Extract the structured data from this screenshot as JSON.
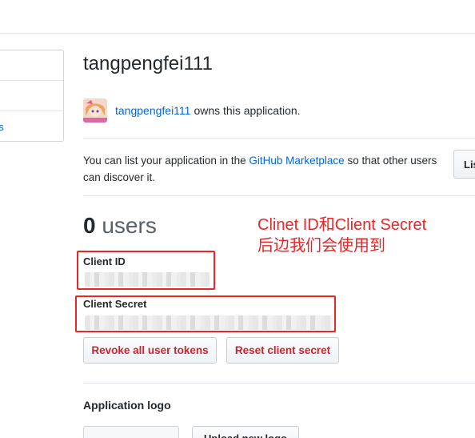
{
  "sidebar": {
    "items": [
      {
        "label": ""
      },
      {
        "label": ""
      },
      {
        "label": "ns"
      }
    ]
  },
  "app": {
    "title": "tangpengfei111",
    "owner_name": "tangpengfei111",
    "owner_text": "owns this application."
  },
  "marketplace": {
    "text_before": "You can list your application in the ",
    "link": "GitHub Marketplace",
    "text_after": " so that other users can discover it.",
    "button_label": "List"
  },
  "users": {
    "count": "0",
    "label": "users"
  },
  "annotation": {
    "line1": "Clinet ID和Client Secret",
    "line2": "后边我们会使用到"
  },
  "credentials": {
    "client_id_label": "Client ID",
    "client_secret_label": "Client Secret"
  },
  "actions": {
    "revoke_label": "Revoke all user tokens",
    "reset_label": "Reset client secret"
  },
  "logo": {
    "title": "Application logo",
    "upload_label": "Upload new logo"
  },
  "colors": {
    "link": "#0366d6",
    "danger": "#cb2431",
    "annotation": "#e8262a"
  }
}
